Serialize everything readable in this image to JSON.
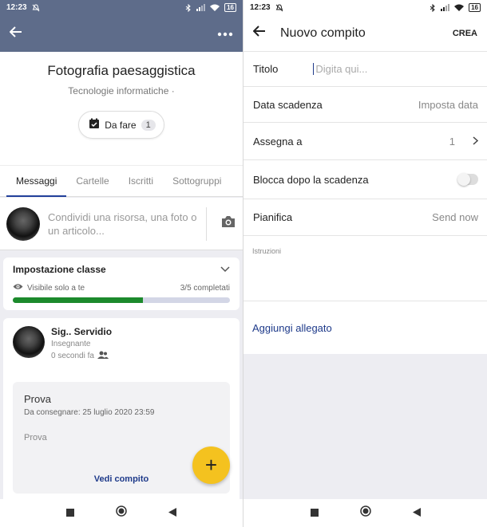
{
  "left": {
    "status": {
      "time": "12:23",
      "battery": "16"
    },
    "header": {
      "title": "Fotografia paesaggistica",
      "subtitle": "Tecnologie informatiche ·",
      "todo_label": "Da fare",
      "todo_count": "1"
    },
    "tabs": [
      "Messaggi",
      "Cartelle",
      "Iscritti",
      "Sottogruppi"
    ],
    "composer": {
      "placeholder": "Condividi una risorsa, una foto o un articolo..."
    },
    "setup": {
      "title": "Impostazione classe",
      "visibility": "Visibile solo a te",
      "progress_text": "3/5 completati",
      "progress_fraction": 0.6
    },
    "post": {
      "author": "Sig.. Servidio",
      "role": "Insegnante",
      "time": "0 secondi fa",
      "assignment": {
        "title": "Prova",
        "due": "Da consegnare: 25 luglio 2020 23:59",
        "body": "Prova",
        "link": "Vedi compito"
      }
    },
    "fab_label": "+"
  },
  "right": {
    "status": {
      "time": "12:23",
      "battery": "16"
    },
    "appbar": {
      "title": "Nuovo compito",
      "action": "CREA"
    },
    "form": {
      "title_label": "Titolo",
      "title_placeholder": "Digita qui...",
      "due_label": "Data scadenza",
      "due_value": "Imposta data",
      "assign_label": "Assegna a",
      "assign_value": "1",
      "lock_label": "Blocca dopo la scadenza",
      "schedule_label": "Pianifica",
      "schedule_value": "Send now",
      "instructions_placeholder": "Istruzioni",
      "attach_label": "Aggiungi allegato"
    }
  },
  "colors": {
    "topbar": "#5e6c8a",
    "accent": "#1e3a8a",
    "progress": "#1c8a2c",
    "fab": "#f4c21f"
  }
}
